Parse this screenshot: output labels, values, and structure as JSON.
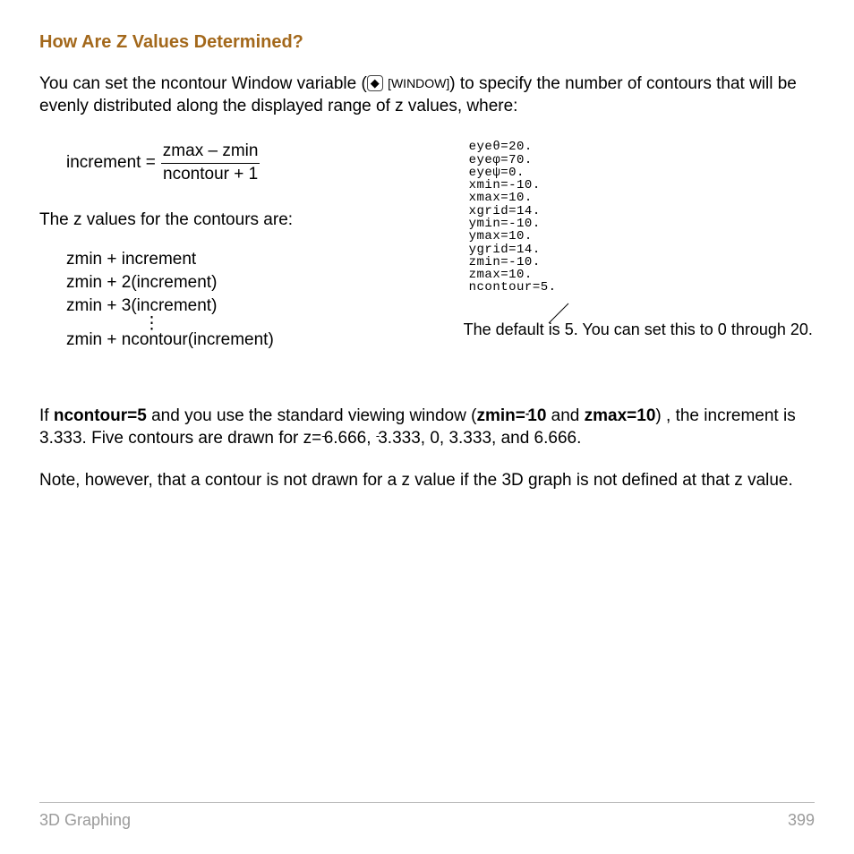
{
  "heading": "How Are Z Values Determined?",
  "intro_1": "You can set the ncontour Window variable (",
  "key_diamond": "◆",
  "key_window": "[WINDOW]",
  "intro_2": ") to specify the number of contours that will be evenly distributed along the displayed range of z values, where:",
  "increment_label": "increment =",
  "frac_num_a": "zmax",
  "frac_num_minus": " – ",
  "frac_num_b": "zmin",
  "frac_den": "ncontour + 1",
  "zvals_label": "The z values for the contours are:",
  "zlist": {
    "a": "zmin + increment",
    "b": "zmin + 2(increment)",
    "c": "zmin + 3(increment)",
    "d": "zmin + ncontour(increment)"
  },
  "calc_screen": "eyeθ=20.\neyeφ=70.\neyeψ=0.\nxmin=-10.\nxmax=10.\nxgrid=14.\nymin=-10.\nymax=10.\nygrid=14.\nzmin=-10.\nzmax=10.\nncontour=5.",
  "annotation": "The default is 5. You can set this to 0 through 20.",
  "p2_a": "If ",
  "p2_b": "ncontour=5",
  "p2_c": " and you use the standard viewing window (",
  "p2_d": "zmin=",
  "p2_d_neg": "-",
  "p2_d2": "10",
  "p2_e": " and ",
  "p2_f": "zmax=10",
  "p2_g": ") , the increment is 3.333. Five contours are drawn for z=",
  "p2_h_neg": "-",
  "p2_h": "6.666, ",
  "p2_i_neg": "-",
  "p2_i": "3.333, 0, 3.333, and 6.666.",
  "p3": "Note, however, that a contour is not drawn for a z value if the 3D graph is not defined at that z value.",
  "footer_left": "3D Graphing",
  "footer_right": "399"
}
